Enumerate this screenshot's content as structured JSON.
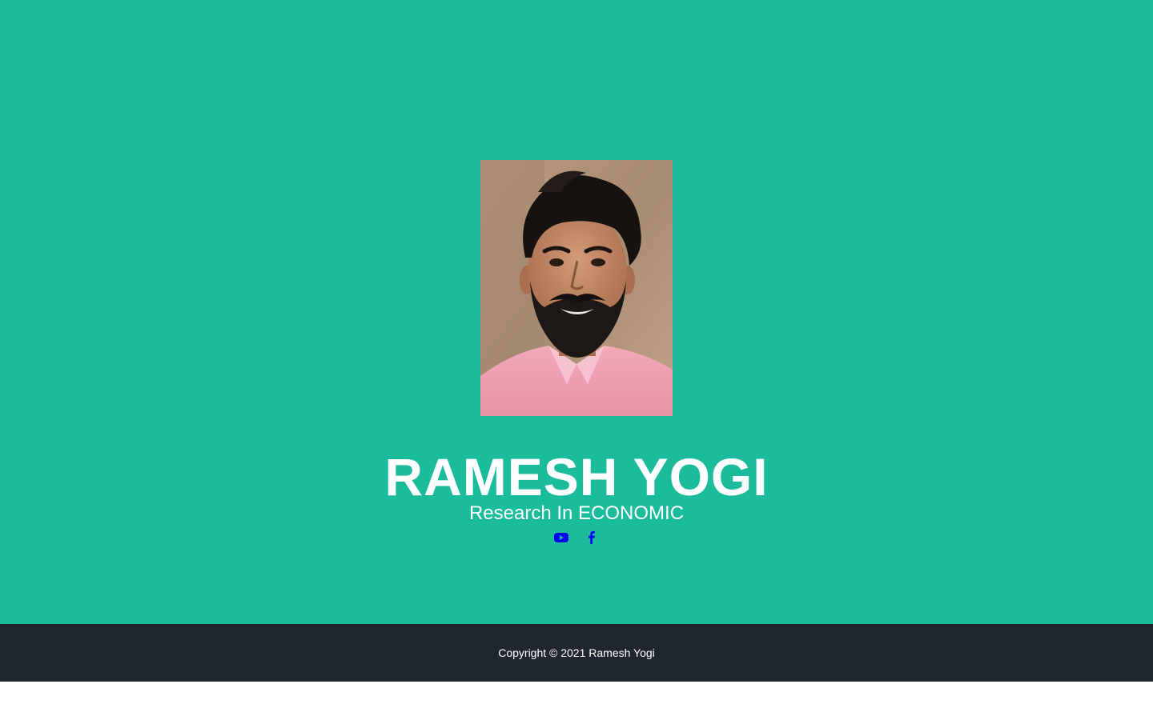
{
  "profile": {
    "name": "RAMESH YOGI",
    "tagline": "Research In ECONOMIC",
    "photo_alt": "Ramesh Yogi"
  },
  "social": [
    {
      "icon": "youtube-icon",
      "label": "YouTube"
    },
    {
      "icon": "facebook-icon",
      "label": "Facebook"
    }
  ],
  "footer": {
    "copyright": "Copyright © 2021 Ramesh Yogi"
  },
  "colors": {
    "hero_bg": "#1abc9c",
    "footer_bg": "#1f2630",
    "text": "#ffffff",
    "social_icon": "#0000ff"
  }
}
